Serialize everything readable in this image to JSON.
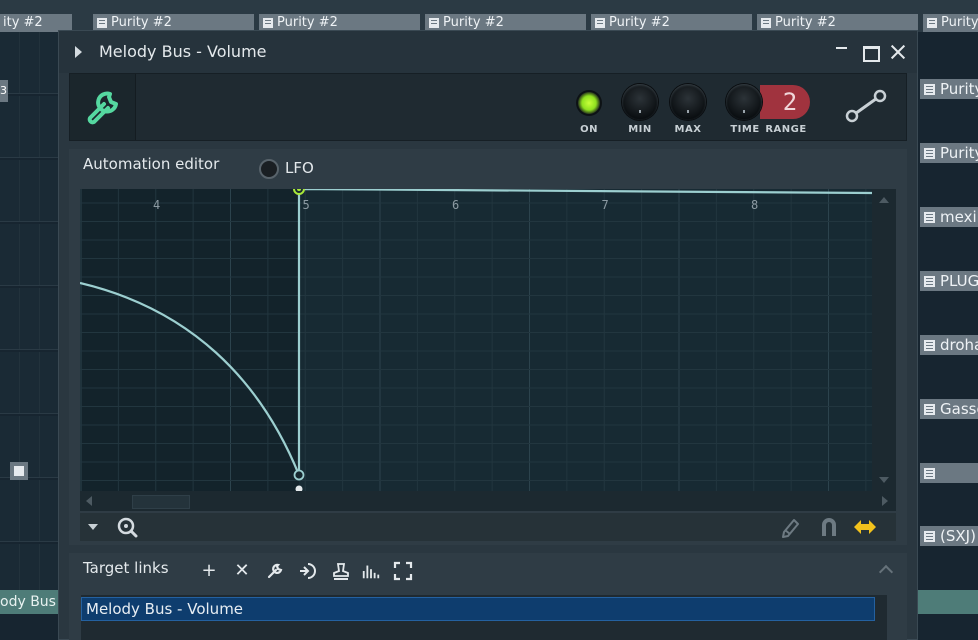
{
  "background": {
    "top_tabs": [
      "ity #2",
      "Purity #2",
      "Purity #2",
      "Purity #2",
      "Purity #2",
      "Purity #2",
      "Purity"
    ],
    "right_clips": [
      "Purity",
      "Purity",
      "mexik",
      "PLUGG",
      "droha",
      "Gasse",
      "(SXJ)"
    ],
    "bottom_left_label": "ody Bus",
    "left_marker_text": "3"
  },
  "window": {
    "title": "Melody Bus - Volume"
  },
  "header": {
    "on_label": "ON",
    "min_label": "MIN",
    "max_label": "MAX",
    "time_label": "TIME",
    "range_label": "RANGE",
    "range_value": "2"
  },
  "automation_editor": {
    "title": "Automation editor",
    "lfo_label": "LFO",
    "bar_numbers": [
      "4",
      "5",
      "6",
      "7",
      "8"
    ]
  },
  "target_links": {
    "title": "Target links",
    "items": [
      "Melody Bus - Volume"
    ]
  },
  "colors": {
    "accent_green": "#8fe11f",
    "curve": "#9ccfd0",
    "range_red": "#a0333e",
    "selection_blue": "#0e3d6e",
    "tool_yellow": "#f2c21c",
    "wrench_green": "#55d8a0"
  }
}
